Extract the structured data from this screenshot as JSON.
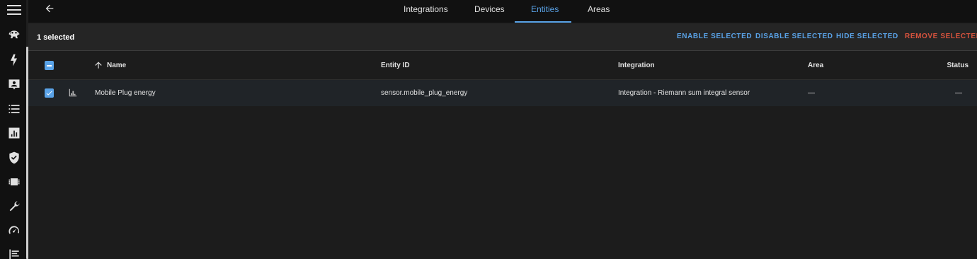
{
  "nav": {
    "tabs": [
      {
        "label": "Integrations"
      },
      {
        "label": "Devices"
      },
      {
        "label": "Entities"
      },
      {
        "label": "Areas"
      }
    ],
    "active_tab": "Entities"
  },
  "sidebar": {
    "icons": [
      "menu-icon",
      "hub-icon",
      "lightning-icon",
      "person-badge-icon",
      "list-icon",
      "chart-icon",
      "shield-icon",
      "chip-icon",
      "wrench-icon",
      "speedometer-icon",
      "logbook-icon"
    ]
  },
  "selection": {
    "count_label": "1 selected",
    "actions": {
      "enable": "ENABLE SELECTED",
      "disable": "DISABLE SELECTED",
      "hide": "HIDE SELECTED",
      "remove": "REMOVE SELECTED"
    }
  },
  "table": {
    "columns": {
      "name": "Name",
      "entity_id": "Entity ID",
      "integration": "Integration",
      "area": "Area",
      "status": "Status"
    },
    "rows": [
      {
        "name": "Mobile Plug energy",
        "entity_id": "sensor.mobile_plug_energy",
        "integration": "Integration - Riemann sum integral sensor",
        "area": "—",
        "status": "—",
        "selected": true
      }
    ]
  },
  "colors": {
    "accent": "#5aa3e8",
    "danger": "#d9533e",
    "background": "#1c1c1c",
    "sidebar": "#111111"
  }
}
